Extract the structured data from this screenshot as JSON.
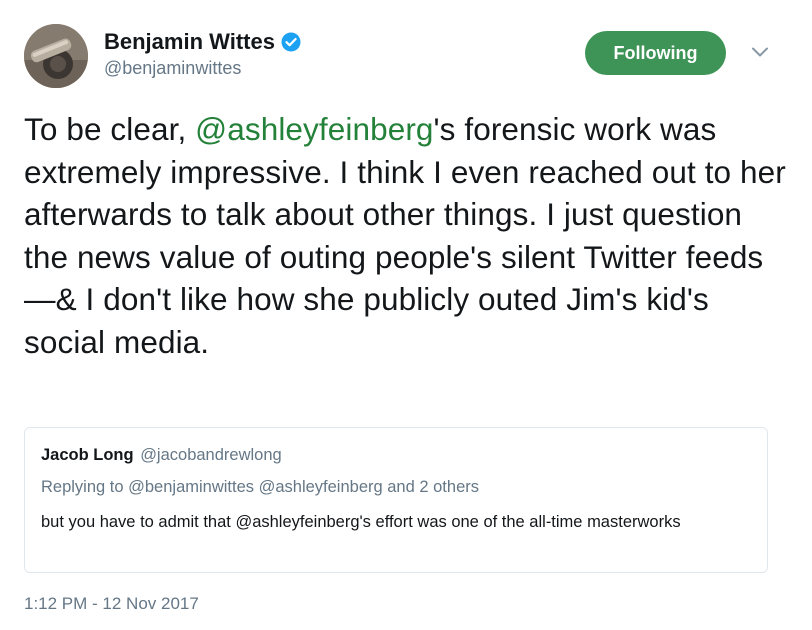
{
  "author": {
    "name": "Benjamin Wittes",
    "handle": "@benjaminwittes",
    "verified": true
  },
  "follow_button": {
    "label": "Following",
    "color": "#3e9456"
  },
  "tweet": {
    "text_before": "To be clear, ",
    "mention": "@ashleyfeinberg",
    "text_after": "'s forensic work was extremely impressive. I think I even reached out to her afterwards to talk about other things. I just question the news value of outing people's silent Twitter feeds—& I don't like how she publicly outed Jim's kid's social media.",
    "link_color": "#24813a"
  },
  "quoted_tweet": {
    "author_name": "Jacob Long",
    "author_handle": "@jacobandrewlong",
    "replying_to": "Replying to @benjaminwittes @ashleyfeinberg and 2 others",
    "text": "but you have to admit that @ashleyfeinberg's effort was one of the all-time masterworks"
  },
  "timestamp": "1:12 PM - 12 Nov 2017",
  "icons": {
    "verified": "verified-badge-icon",
    "caret": "chevron-down-icon"
  }
}
